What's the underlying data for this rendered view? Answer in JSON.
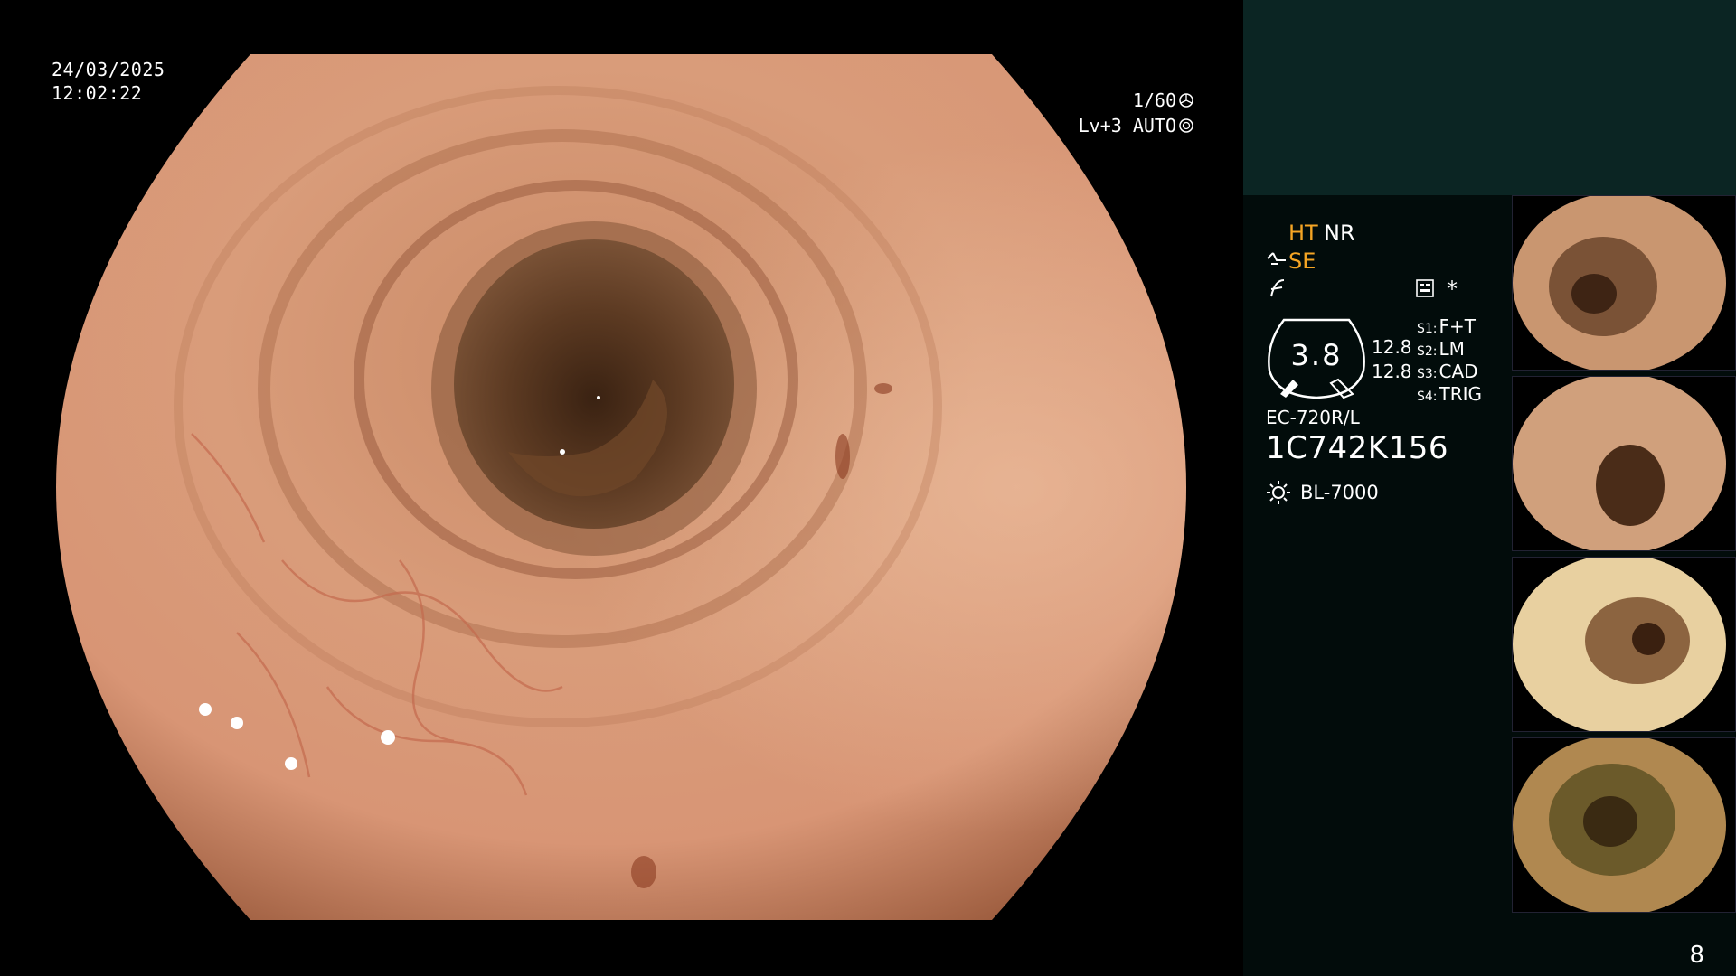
{
  "overlay": {
    "date": "24/03/2025",
    "time": "12:02:22",
    "shutter": "1/60",
    "level": "Lv+3 AUTO"
  },
  "panel": {
    "mode_ht": "HT",
    "mode_nr": "NR",
    "mode_se": "SE",
    "dial_value": "3.8",
    "val_top": "12.8",
    "val_bottom": "12.8",
    "slots": [
      {
        "key": "S1:",
        "value": "F+T"
      },
      {
        "key": "S2:",
        "value": "LM"
      },
      {
        "key": "S3:",
        "value": "CAD"
      },
      {
        "key": "S4:",
        "value": "TRIG"
      }
    ],
    "scope_model": "EC-720R/L",
    "serial": "1C742K156",
    "light_source": "BL-7000",
    "asterisk": "*"
  },
  "colors": {
    "panel_bg": "#020c0b",
    "panel_top_bg": "#0b2523",
    "accent": "#f5a524"
  },
  "page_number": "8"
}
